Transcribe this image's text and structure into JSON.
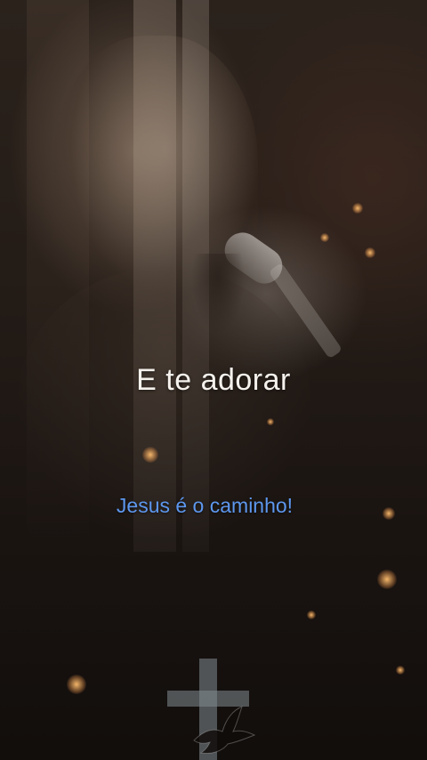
{
  "lyrics": {
    "line": "E te adorar"
  },
  "caption": {
    "text": "Jesus é o caminho!",
    "color": "#5d97ee"
  },
  "watermark": {
    "icon": "cross-with-dove-icon"
  }
}
